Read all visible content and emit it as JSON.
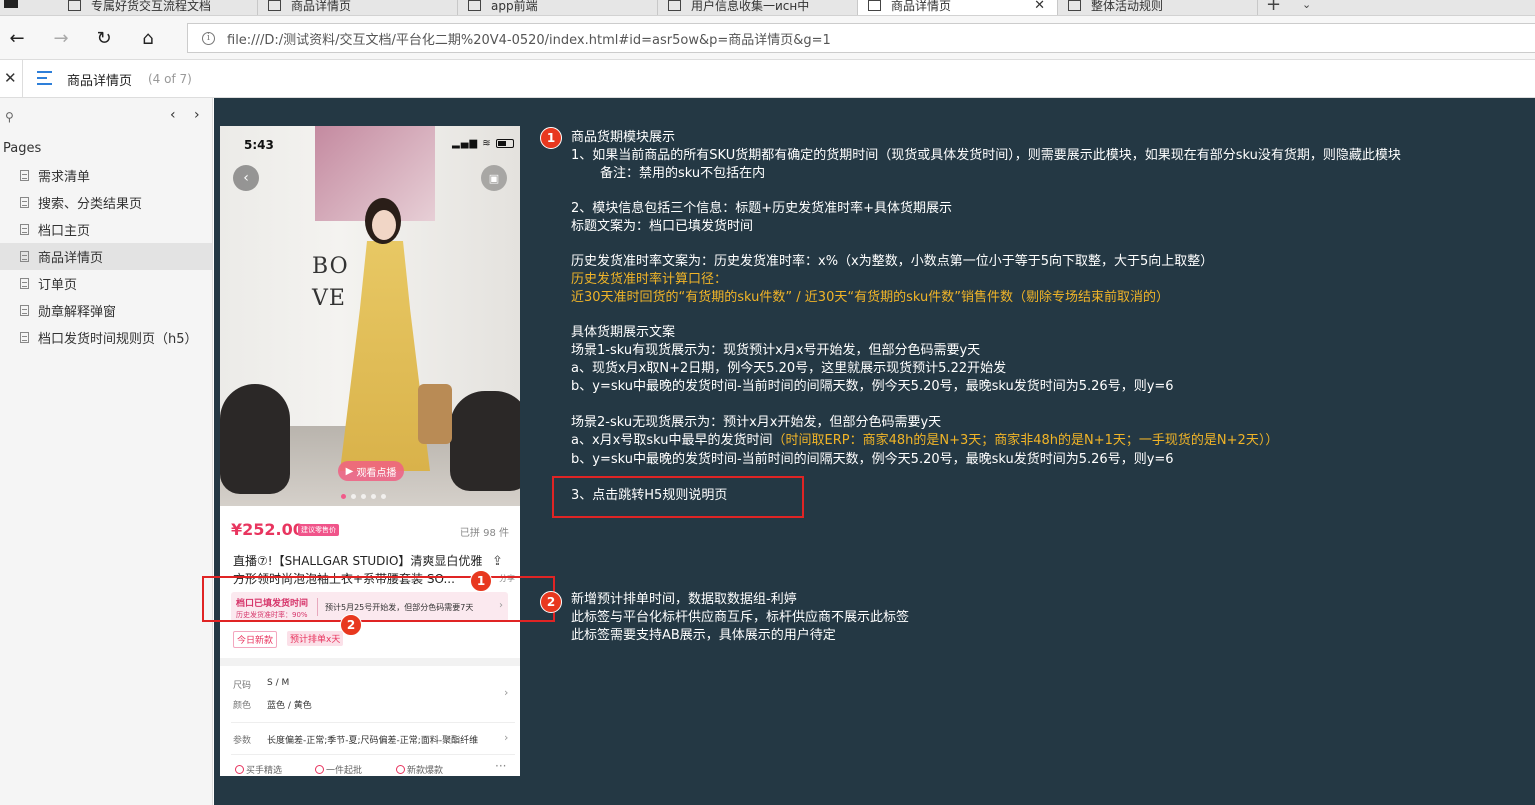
{
  "browser": {
    "tabs": [
      {
        "label": "专属好货交互流程文档",
        "active": false
      },
      {
        "label": "商品详情页",
        "active": false
      },
      {
        "label": "app前端",
        "active": false
      },
      {
        "label": "用户信息收集一исн中",
        "active": false
      },
      {
        "label": "商品详情页",
        "active": true
      },
      {
        "label": "整体活动规则",
        "active": false
      }
    ],
    "url": "file:///D:/测试资料/交互文档/平台化二期%20V4-0520/index.html#id=asr5ow&p=商品详情页&g=1"
  },
  "axure": {
    "page_title": "商品详情页",
    "page_count": "(4 of 7)"
  },
  "sidebar": {
    "pages_heading": "Pages",
    "items": [
      {
        "label": "需求清单"
      },
      {
        "label": "搜索、分类结果页"
      },
      {
        "label": "档口主页"
      },
      {
        "label": "商品详情页"
      },
      {
        "label": "订单页"
      },
      {
        "label": "勋章解释弹窗"
      },
      {
        "label": "档口发货时间规则页（h5）"
      }
    ]
  },
  "phone": {
    "time": "5:43",
    "bo_text_1": "BO",
    "bo_text_2": "VE",
    "video_label": "观看点播",
    "price": "¥252.00",
    "price_tag": "建议零售价",
    "sold": "已拼 98 件",
    "title": "直播⑦!【SHALLGAR STUDIO】清爽显白优雅方形领时尚泡泡袖上衣+系带腰套装 SO...",
    "share_label": "分享",
    "delivery_title": "档口已填发货时间",
    "delivery_rate": "历史发货准时率：90%",
    "delivery_text": "预计5月25号开始发，但部分色码需要7天",
    "tag_new": "今日新款",
    "tag_pre": "预计排单x天",
    "size_label": "尺码",
    "size_value": "S / M",
    "color_label": "颜色",
    "color_value": "蓝色 / 黄色",
    "param_label": "参数",
    "param_value": "长度偏差-正常;季节-夏;尺码偏差-正常;面料-聚酯纤维",
    "badges": [
      "买手精选",
      "一件起批",
      "新款爆款"
    ],
    "more": "···"
  },
  "markers": {
    "one": "1",
    "two": "2"
  },
  "notes": {
    "n1_title": "商品货期模块展示",
    "n1_l1": "1、如果当前商品的所有SKU货期都有确定的货期时间（现货或具体发货时间），则需要展示此模块，如果现在有部分sku没有货期，则隐藏此模块",
    "n1_l2": "备注：禁用的sku不包括在内",
    "n1_l3": "2、模块信息包括三个信息：标题+历史发货准时率+具体货期展示",
    "n1_l4": "标题文案为：档口已填发货时间",
    "n1_l5": "历史发货准时率文案为：历史发货准时率：x%（x为整数，小数点第一位小于等于5向下取整，大于5向上取整）",
    "n1_l6": "历史发货准时率计算口径：",
    "n1_l7": "近30天准时回货的“有货期的sku件数” / 近30天“有货期的sku件数”销售件数（剔除专场结束前取消的）",
    "n1_l8": "具体货期展示文案",
    "n1_l9": "场景1-sku有现货展示为：现货预计x月x号开始发，但部分色码需要y天",
    "n1_l10": "a、现货x月x取N+2日期，例今天5.20号，这里就展示现货预计5.22开始发",
    "n1_l11": "b、y=sku中最晚的发货时间-当前时间的间隔天数，例今天5.20号，最晚sku发货时间为5.26号，则y=6",
    "n1_l12": "场景2-sku无现货展示为：预计x月x开始发，但部分色码需要y天",
    "n1_l13a": "a、x月x号取sku中最早的发货时间",
    "n1_l13b": "（时间取ERP：商家48h的是N+3天；商家非48h的是N+1天；一手现货的是N+2天））",
    "n1_l14": "b、y=sku中最晚的发货时间-当前时间的间隔天数，例今天5.20号，最晚sku发货时间为5.26号，则y=6",
    "n1_l15": "3、点击跳转H5规则说明页",
    "n2_l1": "新增预计排单时间，数据取数据组-利婷",
    "n2_l2": "此标签与平台化标杆供应商互斥，标杆供应商不展示此标签",
    "n2_l3": "此标签需要支持AB展示，具体展示的用户待定"
  },
  "colors": {
    "canvas": "#243844",
    "highlight": "#f0b428",
    "marker": "#e8381f",
    "box": "#e02424"
  }
}
